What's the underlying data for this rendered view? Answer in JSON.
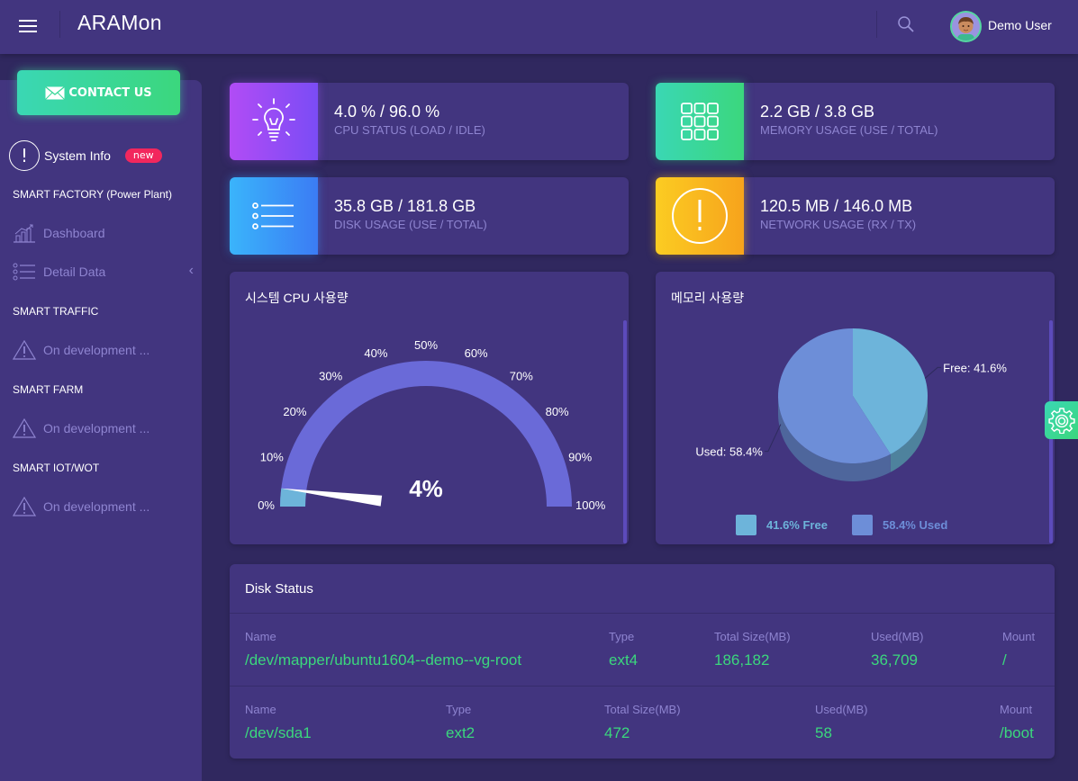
{
  "header": {
    "app_title": "ARAMon",
    "user_name": "Demo User",
    "icons": {
      "menu": "hamburger-icon",
      "search": "search-icon",
      "avatar": "user-avatar"
    }
  },
  "sidebar": {
    "contact_label": "CONTACT US",
    "system_info_label": "System Info",
    "system_info_badge": "new",
    "sections": [
      {
        "title": "SMART FACTORY (Power Plant)",
        "items": [
          {
            "label": "Dashboard",
            "icon": "chart-icon"
          },
          {
            "label": "Detail Data",
            "icon": "list-icon",
            "expandable": true
          }
        ]
      },
      {
        "title": "SMART TRAFFIC",
        "items": [
          {
            "label": "On development ...",
            "icon": "warning-icon"
          }
        ]
      },
      {
        "title": "SMART FARM",
        "items": [
          {
            "label": "On development ...",
            "icon": "warning-icon"
          }
        ]
      },
      {
        "title": "SMART IOT/WOT",
        "items": [
          {
            "label": "On development ...",
            "icon": "warning-icon"
          }
        ]
      }
    ]
  },
  "stats": [
    {
      "value": "4.0 % / 96.0 %",
      "label": "CPU STATUS (LOAD / IDLE)",
      "icon": "lightbulb-icon",
      "gradient": [
        "#b14cf5",
        "#7b4cf5"
      ]
    },
    {
      "value": "2.2 GB / 3.8 GB",
      "label": "MEMORY USAGE (USE / TOTAL)",
      "icon": "grid-icon",
      "gradient": [
        "#3ad7b4",
        "#3bd77d"
      ]
    },
    {
      "value": "35.8 GB / 181.8 GB",
      "label": "DISK USAGE (USE / TOTAL)",
      "icon": "list-icon",
      "gradient": [
        "#3ab4fb",
        "#3b7cf4"
      ]
    },
    {
      "value": "120.5 MB / 146.0 MB",
      "label": "NETWORK USAGE (RX / TX)",
      "icon": "alert-circle-icon",
      "gradient": [
        "#fbcc22",
        "#f7a31c"
      ]
    }
  ],
  "cpu_panel": {
    "title": "시스템 CPU 사용량"
  },
  "memory_panel": {
    "title": "메모리 사용량"
  },
  "chart_data": [
    {
      "type": "gauge",
      "title": "시스템 CPU 사용량",
      "value": 4,
      "value_label": "4%",
      "range": [
        0,
        100
      ],
      "tick_labels": [
        "0%",
        "10%",
        "20%",
        "30%",
        "40%",
        "50%",
        "60%",
        "70%",
        "80%",
        "90%",
        "100%"
      ],
      "colors": {
        "band": "#6a6ad8",
        "fill": "#6db4da",
        "needle": "#ffffff"
      }
    },
    {
      "type": "pie",
      "title": "메모리 사용량",
      "style": "3d",
      "slices": [
        {
          "name": "Free",
          "value": 41.6,
          "label": "Free: 41.6%",
          "color": "#6db4da"
        },
        {
          "name": "Used",
          "value": 58.4,
          "label": "Used: 58.4%",
          "color": "#6d8ed8"
        }
      ],
      "legend": [
        {
          "pct": "41.6%",
          "name": "Free",
          "color": "#6db4da"
        },
        {
          "pct": "58.4%",
          "name": "Used",
          "color": "#6d8ed8"
        }
      ],
      "legend_position": "bottom"
    }
  ],
  "disk_status": {
    "title": "Disk Status",
    "rows": [
      {
        "headers": [
          "Name",
          "Type",
          "Total Size(MB)",
          "Used(MB)",
          "Mount"
        ],
        "values": [
          "/dev/mapper/ubuntu1604--demo--vg-root",
          "ext4",
          "186,182",
          "36,709",
          "/"
        ]
      },
      {
        "headers": [
          "Name",
          "Type",
          "Total Size(MB)",
          "Used(MB)",
          "Mount"
        ],
        "values": [
          "/dev/sda1",
          "ext2",
          "472",
          "58",
          "/boot"
        ]
      }
    ]
  },
  "settings": {
    "icon": "gear-icon"
  }
}
